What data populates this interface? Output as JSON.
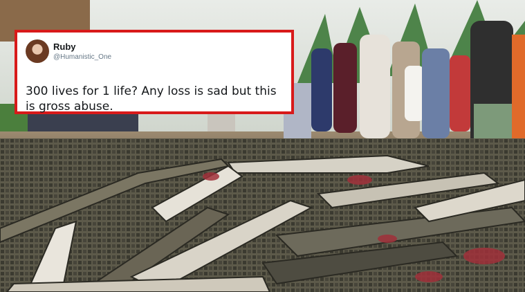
{
  "tweet": {
    "display_name": "Ruby",
    "handle": "@Humanistic_One",
    "text": "300 lives for 1 life? Any loss is sad but this is gross abuse."
  },
  "colors": {
    "tweet_border": "#d81a1a",
    "tweet_background": "#ffffff"
  },
  "icons": {
    "avatar": "profile-photo"
  }
}
